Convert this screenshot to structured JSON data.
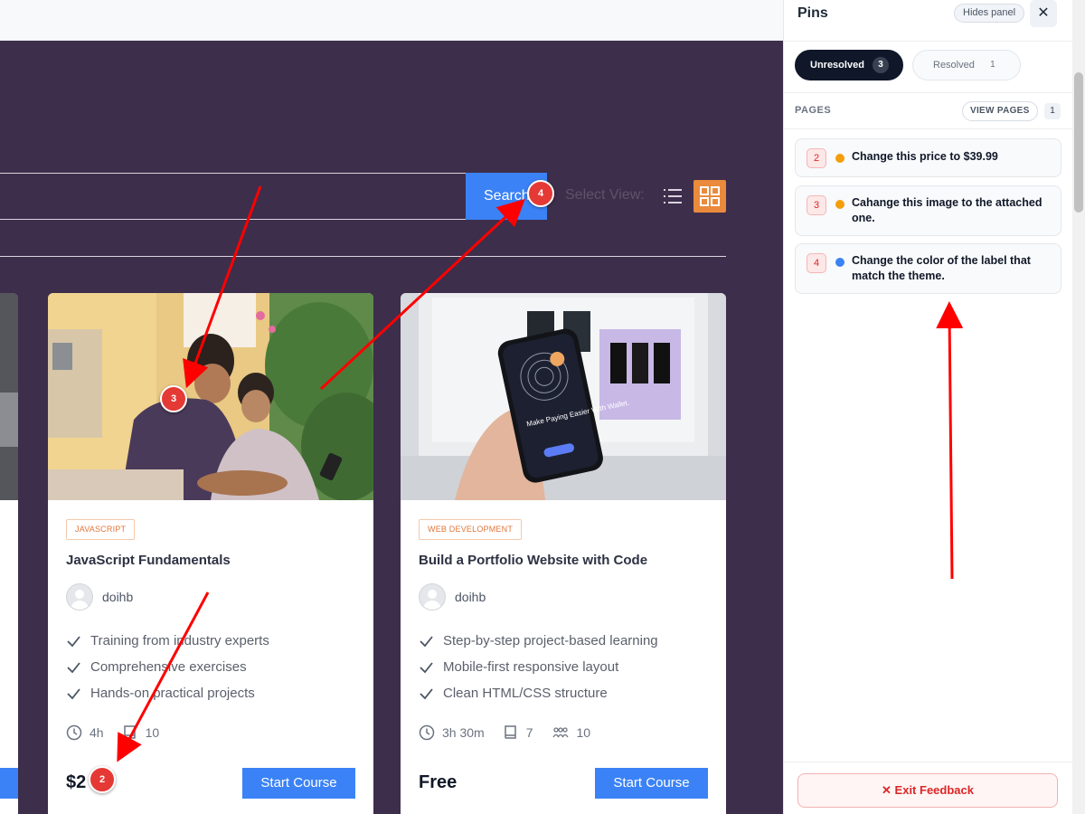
{
  "search": {
    "button_label": "Search"
  },
  "view": {
    "select_label": "Select View:"
  },
  "courses": [
    {
      "tag": "JAVASCRIPT",
      "title": "JavaScript Fundamentals",
      "author": "doihb",
      "features": [
        "Training from industry experts",
        "Comprehensive exercises",
        "Hands-on practical projects"
      ],
      "duration": "4h",
      "lessons": "10",
      "price": "$2 9",
      "button": "Start Course"
    },
    {
      "tag": "WEB DEVELOPMENT",
      "title": "Build a Portfolio Website with Code",
      "author": "doihb",
      "features": [
        "Step-by-step project-based learning",
        "Mobile-first responsive layout",
        "Clean HTML/CSS structure"
      ],
      "duration": "3h 30m",
      "lessons": "7",
      "students": "10",
      "price": "Free",
      "button": "Start Course"
    }
  ],
  "phone_screen": {
    "headline": "Make Paying Easier With Wallet."
  },
  "pins_on_page": {
    "p2": "2",
    "p3": "3",
    "p4": "4"
  },
  "panel": {
    "title": "Pins",
    "hide_label": "Hides panel",
    "close_glyph": "✕",
    "tabs": {
      "unresolved_label": "Unresolved",
      "unresolved_count": "3",
      "resolved_label": "Resolved",
      "resolved_count": "1"
    },
    "pages_label": "PAGES",
    "view_pages_label": "VIEW PAGES",
    "pages_count": "1",
    "items": [
      {
        "num": "2",
        "text": "Change this price to $39.99",
        "dot_color": "#f59e0b"
      },
      {
        "num": "3",
        "text": "Cahange this image to the attached one.",
        "dot_color": "#f59e0b"
      },
      {
        "num": "4",
        "text": "Change the color of the label that match the theme.",
        "dot_color": "#3b82f6"
      }
    ],
    "exit_label": "Exit Feedback"
  },
  "colors": {
    "hero": "#3d2e4b",
    "primary": "#3b82f6",
    "accent": "#ea8a3c",
    "pin": "#e53935",
    "arrow": "#ff0000"
  }
}
